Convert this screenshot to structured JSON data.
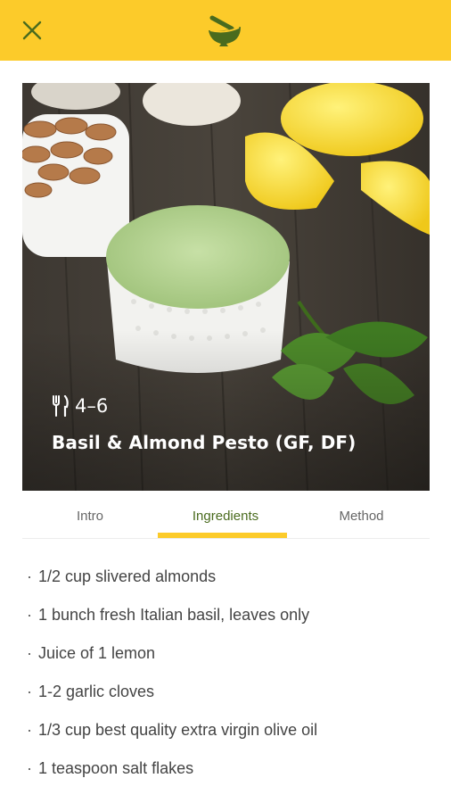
{
  "header": {
    "close_icon": "close-icon",
    "logo_icon": "mortar-pestle-icon",
    "background_color": "#FCCB2A"
  },
  "hero": {
    "image_description_icon": "recipe-photo",
    "serves": "4–6",
    "serves_icon": "fork-knife-icon",
    "title": "Basil & Almond Pesto (GF, DF)"
  },
  "tabs": [
    {
      "label": "Intro",
      "active": false
    },
    {
      "label": "Ingredients",
      "active": true
    },
    {
      "label": "Method",
      "active": false
    }
  ],
  "ingredients": [
    "1/2 cup slivered almonds",
    "1 bunch fresh Italian basil, leaves only",
    "Juice of 1 lemon",
    "1-2 garlic cloves",
    "1/3 cup best quality extra virgin olive oil",
    "1 teaspoon salt flakes"
  ],
  "colors": {
    "accent": "#FCCB2A",
    "active_tab_text": "#4a6b1e",
    "logo_green": "#5a7d1f"
  }
}
